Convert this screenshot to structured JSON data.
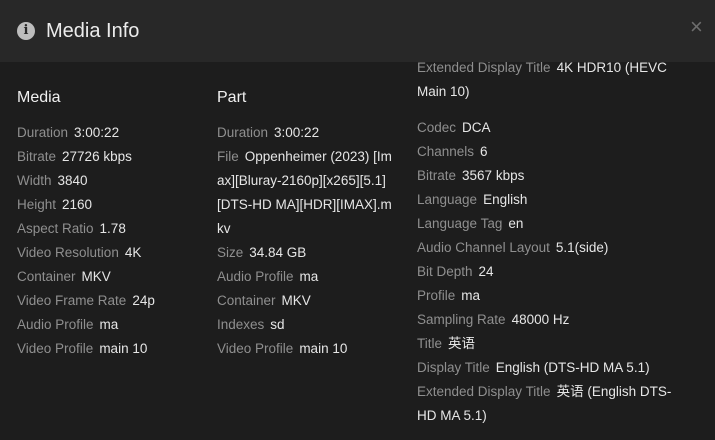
{
  "dialog": {
    "title": "Media Info",
    "info_icon": "info-icon",
    "close_label": "×",
    "close_icon": "close-icon"
  },
  "media": {
    "heading": "Media",
    "rows": [
      {
        "key": "Duration",
        "value": "3:00:22"
      },
      {
        "key": "Bitrate",
        "value": "27726 kbps"
      },
      {
        "key": "Width",
        "value": "3840"
      },
      {
        "key": "Height",
        "value": "2160"
      },
      {
        "key": "Aspect Ratio",
        "value": "1.78"
      },
      {
        "key": "Video Resolution",
        "value": "4K"
      },
      {
        "key": "Container",
        "value": "MKV"
      },
      {
        "key": "Video Frame Rate",
        "value": "24p"
      },
      {
        "key": "Audio Profile",
        "value": "ma"
      },
      {
        "key": "Video Profile",
        "value": "main 10"
      }
    ]
  },
  "part": {
    "heading": "Part",
    "rows": [
      {
        "key": "Duration",
        "value": "3:00:22"
      },
      {
        "key": "File",
        "value": "Oppenheimer (2023) [Imax][Bluray-2160p][x265][5.1][DTS-HD MA][HDR][IMAX].mkv"
      },
      {
        "key": "Size",
        "value": "34.84 GB"
      },
      {
        "key": "Audio Profile",
        "value": "ma"
      },
      {
        "key": "Container",
        "value": "MKV"
      },
      {
        "key": "Indexes",
        "value": "sd"
      },
      {
        "key": "Video Profile",
        "value": "main 10"
      }
    ]
  },
  "video_stream_tail": {
    "rows": [
      {
        "key": "Extended Display Title",
        "value": "4K HDR10 (HEVC Main 10)"
      }
    ]
  },
  "audio_stream": {
    "rows": [
      {
        "key": "Codec",
        "value": "DCA"
      },
      {
        "key": "Channels",
        "value": "6"
      },
      {
        "key": "Bitrate",
        "value": "3567 kbps"
      },
      {
        "key": "Language",
        "value": "English"
      },
      {
        "key": "Language Tag",
        "value": "en"
      },
      {
        "key": "Audio Channel Layout",
        "value": "5.1(side)"
      },
      {
        "key": "Bit Depth",
        "value": "24"
      },
      {
        "key": "Profile",
        "value": "ma"
      },
      {
        "key": "Sampling Rate",
        "value": "48000 Hz"
      },
      {
        "key": "Title",
        "value": "英语"
      },
      {
        "key": "Display Title",
        "value": "English (DTS-HD MA 5.1)"
      },
      {
        "key": "Extended Display Title",
        "value": "英语 (English DTS-HD MA 5.1)"
      }
    ]
  }
}
